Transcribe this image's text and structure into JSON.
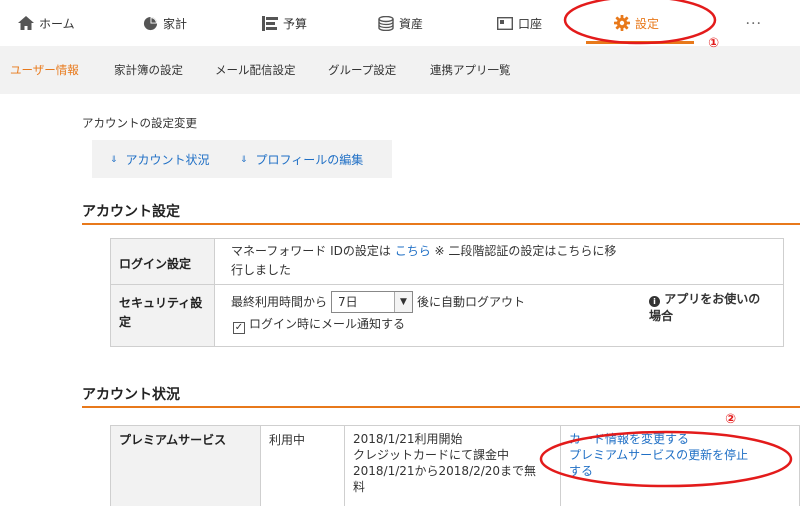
{
  "nav": {
    "items": [
      {
        "label": "ホーム",
        "icon": "home-icon"
      },
      {
        "label": "家計",
        "icon": "pie-chart-icon"
      },
      {
        "label": "予算",
        "icon": "budget-icon"
      },
      {
        "label": "資産",
        "icon": "coins-icon"
      },
      {
        "label": "口座",
        "icon": "account-icon"
      },
      {
        "label": "設定",
        "icon": "gear-icon"
      }
    ],
    "more": "･･･",
    "accent": "#e8791b"
  },
  "subnav": {
    "items": [
      "ユーザー情報",
      "家計簿の設定",
      "メール配信設定",
      "グループ設定",
      "連携アプリ一覧"
    ]
  },
  "intro": {
    "heading": "アカウントの設定変更",
    "links": [
      "アカウント状況",
      "プロフィールの編集"
    ]
  },
  "account_settings": {
    "title": "アカウント設定",
    "login": {
      "header": "ログイン設定",
      "text_pre": "マネーフォワード IDの設定は",
      "link": "こちら",
      "text_post1": "※ 二段階認証の設定はこちらに移",
      "text_post2": "行しました"
    },
    "security": {
      "header_line1": "セキュリティ設",
      "header_line2": "定",
      "pre": "最終利用時間から",
      "select_value": "7日",
      "post": "後に自動ログアウト",
      "checkbox_label": "ログイン時にメール通知する",
      "info_line1": "アプリをお使いの",
      "info_line2": "場合"
    }
  },
  "account_status": {
    "title": "アカウント状況",
    "premium": {
      "header": "プレミアムサービス",
      "status": "利用中",
      "detail_line1": "2018/1/21利用開始",
      "detail_line2": "クレジットカードにて課金中",
      "detail_line3": "2018/1/21から2018/2/20まで無",
      "detail_line4": "料",
      "link1": "カード情報を変更する",
      "link2_line1": "プレミアムサービスの更新を停止",
      "link2_line2": "する"
    }
  },
  "annotations": {
    "mark1": "①",
    "mark2": "②",
    "color": "#e31b1b"
  }
}
